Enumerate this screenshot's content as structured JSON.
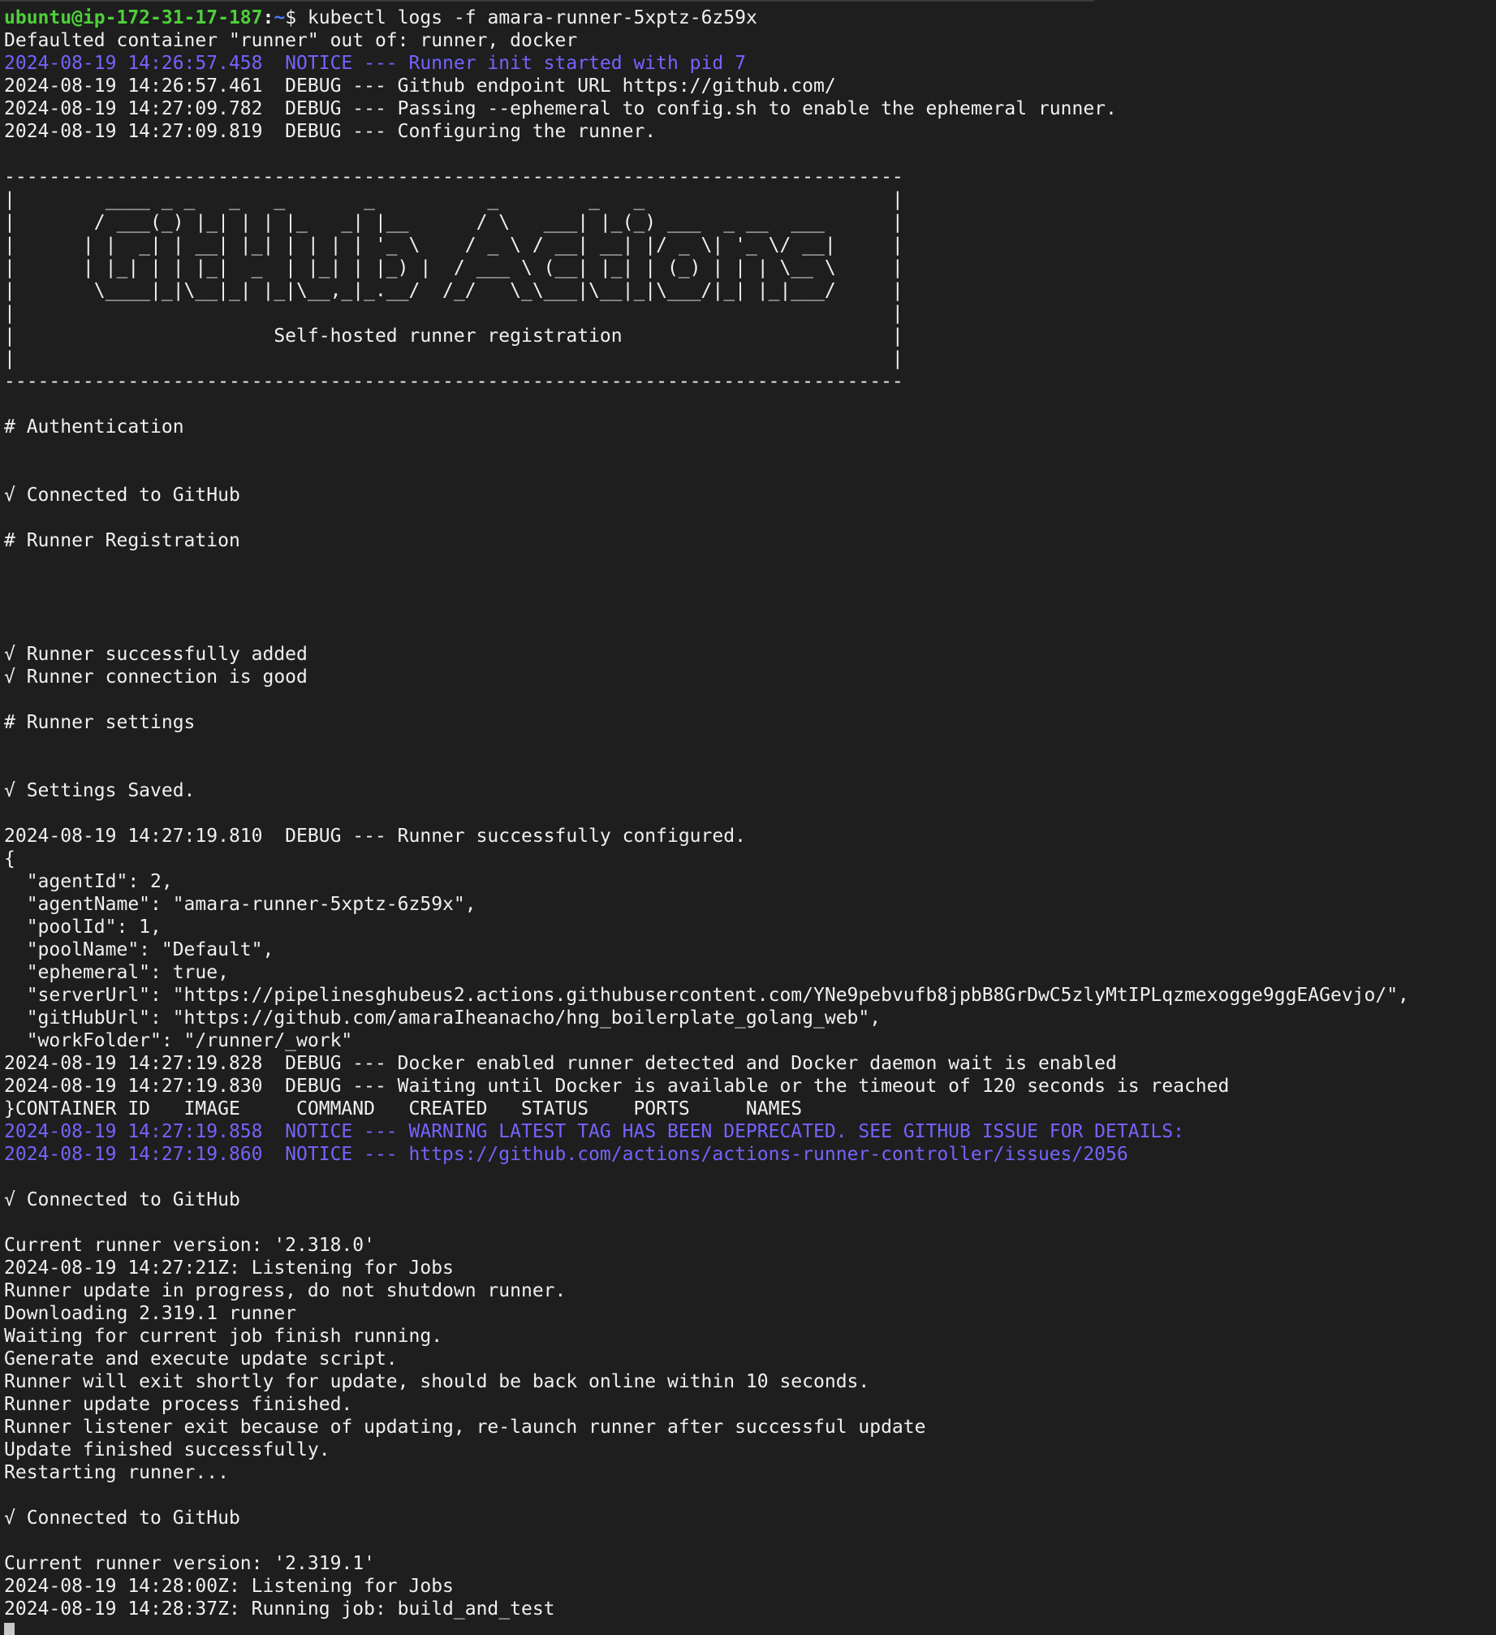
{
  "prompt": {
    "user_host": "ubuntu@ip-172-31-17-187",
    "separator": ":",
    "path": "~",
    "symbol": "$ ",
    "command": "kubectl logs -f amara-runner-5xptz-6z59x"
  },
  "colors": {
    "background": "#1e1e1e",
    "text": "#f0f0f0",
    "prompt_user": "#4ed03a",
    "prompt_path": "#4a7bff",
    "notice": "#7663ff",
    "cursor": "#c8c8c8"
  },
  "lines": [
    {
      "text": "Defaulted container \"runner\" out of: runner, docker",
      "style": "normal"
    },
    {
      "text": "2024-08-19 14:26:57.458  NOTICE --- Runner init started with pid 7",
      "style": "notice"
    },
    {
      "text": "2024-08-19 14:26:57.461  DEBUG --- Github endpoint URL https://github.com/",
      "style": "normal"
    },
    {
      "text": "2024-08-19 14:27:09.782  DEBUG --- Passing --ephemeral to config.sh to enable the ephemeral runner.",
      "style": "normal"
    },
    {
      "text": "2024-08-19 14:27:09.819  DEBUG --- Configuring the runner.",
      "style": "normal"
    },
    {
      "text": "",
      "style": "normal"
    },
    {
      "text": "--------------------------------------------------------------------------------",
      "style": "normal"
    },
    {
      "text": "|        ____ _ _   _   _       _          _        _   _                      |",
      "style": "normal"
    },
    {
      "text": "|       / ___(_) |_| | | |_   _| |__      / \\   ___| |_(_) ___  _ __  ___      |",
      "style": "normal"
    },
    {
      "text": "|      | |  _| | __| |_| | | | | '_ \\    / _ \\ / __| __| |/ _ \\| '_ \\/ __|     |",
      "style": "normal"
    },
    {
      "text": "|      | |_| | | |_|  _  | |_| | |_) |  / ___ \\ (__| |_| | (_) | | | \\__ \\     |",
      "style": "normal"
    },
    {
      "text": "|       \\____|_|\\__|_| |_|\\__,_|_.__/  /_/   \\_\\___|\\__|_|\\___/|_| |_|___/     |",
      "style": "normal"
    },
    {
      "text": "|                                                                              |",
      "style": "normal"
    },
    {
      "text": "|                       Self-hosted runner registration                        |",
      "style": "normal"
    },
    {
      "text": "|                                                                              |",
      "style": "normal"
    },
    {
      "text": "--------------------------------------------------------------------------------",
      "style": "normal"
    },
    {
      "text": "",
      "style": "normal"
    },
    {
      "text": "# Authentication",
      "style": "normal"
    },
    {
      "text": "",
      "style": "normal"
    },
    {
      "text": "",
      "style": "normal"
    },
    {
      "text": "√ Connected to GitHub",
      "style": "normal"
    },
    {
      "text": "",
      "style": "normal"
    },
    {
      "text": "# Runner Registration",
      "style": "normal"
    },
    {
      "text": "",
      "style": "normal"
    },
    {
      "text": "",
      "style": "normal"
    },
    {
      "text": "",
      "style": "normal"
    },
    {
      "text": "",
      "style": "normal"
    },
    {
      "text": "√ Runner successfully added",
      "style": "normal"
    },
    {
      "text": "√ Runner connection is good",
      "style": "normal"
    },
    {
      "text": "",
      "style": "normal"
    },
    {
      "text": "# Runner settings",
      "style": "normal"
    },
    {
      "text": "",
      "style": "normal"
    },
    {
      "text": "",
      "style": "normal"
    },
    {
      "text": "√ Settings Saved.",
      "style": "normal"
    },
    {
      "text": "",
      "style": "normal"
    },
    {
      "text": "2024-08-19 14:27:19.810  DEBUG --- Runner successfully configured.",
      "style": "normal"
    },
    {
      "text": "{",
      "style": "normal"
    },
    {
      "text": "  \"agentId\": 2,",
      "style": "normal"
    },
    {
      "text": "  \"agentName\": \"amara-runner-5xptz-6z59x\",",
      "style": "normal"
    },
    {
      "text": "  \"poolId\": 1,",
      "style": "normal"
    },
    {
      "text": "  \"poolName\": \"Default\",",
      "style": "normal"
    },
    {
      "text": "  \"ephemeral\": true,",
      "style": "normal"
    },
    {
      "text": "  \"serverUrl\": \"https://pipelinesghubeus2.actions.githubusercontent.com/YNe9pebvufb8jpbB8GrDwC5zlyMtIPLqzmexogge9ggEAGevjo/\",",
      "style": "normal"
    },
    {
      "text": "  \"gitHubUrl\": \"https://github.com/amaraIheanacho/hng_boilerplate_golang_web\",",
      "style": "normal"
    },
    {
      "text": "  \"workFolder\": \"/runner/_work\"",
      "style": "normal"
    },
    {
      "text": "2024-08-19 14:27:19.828  DEBUG --- Docker enabled runner detected and Docker daemon wait is enabled",
      "style": "normal"
    },
    {
      "text": "2024-08-19 14:27:19.830  DEBUG --- Waiting until Docker is available or the timeout of 120 seconds is reached",
      "style": "normal"
    },
    {
      "text": "}CONTAINER ID   IMAGE     COMMAND   CREATED   STATUS    PORTS     NAMES",
      "style": "normal"
    },
    {
      "text": "2024-08-19 14:27:19.858  NOTICE --- WARNING LATEST TAG HAS BEEN DEPRECATED. SEE GITHUB ISSUE FOR DETAILS:",
      "style": "notice"
    },
    {
      "text": "2024-08-19 14:27:19.860  NOTICE --- https://github.com/actions/actions-runner-controller/issues/2056",
      "style": "notice"
    },
    {
      "text": "",
      "style": "normal"
    },
    {
      "text": "√ Connected to GitHub",
      "style": "normal"
    },
    {
      "text": "",
      "style": "normal"
    },
    {
      "text": "Current runner version: '2.318.0'",
      "style": "normal"
    },
    {
      "text": "2024-08-19 14:27:21Z: Listening for Jobs",
      "style": "normal"
    },
    {
      "text": "Runner update in progress, do not shutdown runner.",
      "style": "normal"
    },
    {
      "text": "Downloading 2.319.1 runner",
      "style": "normal"
    },
    {
      "text": "Waiting for current job finish running.",
      "style": "normal"
    },
    {
      "text": "Generate and execute update script.",
      "style": "normal"
    },
    {
      "text": "Runner will exit shortly for update, should be back online within 10 seconds.",
      "style": "normal"
    },
    {
      "text": "Runner update process finished.",
      "style": "normal"
    },
    {
      "text": "Runner listener exit because of updating, re-launch runner after successful update",
      "style": "normal"
    },
    {
      "text": "Update finished successfully.",
      "style": "normal"
    },
    {
      "text": "Restarting runner...",
      "style": "normal"
    },
    {
      "text": "",
      "style": "normal"
    },
    {
      "text": "√ Connected to GitHub",
      "style": "normal"
    },
    {
      "text": "",
      "style": "normal"
    },
    {
      "text": "Current runner version: '2.319.1'",
      "style": "normal"
    },
    {
      "text": "2024-08-19 14:28:00Z: Listening for Jobs",
      "style": "normal"
    },
    {
      "text": "2024-08-19 14:28:37Z: Running job: build_and_test",
      "style": "normal"
    }
  ]
}
